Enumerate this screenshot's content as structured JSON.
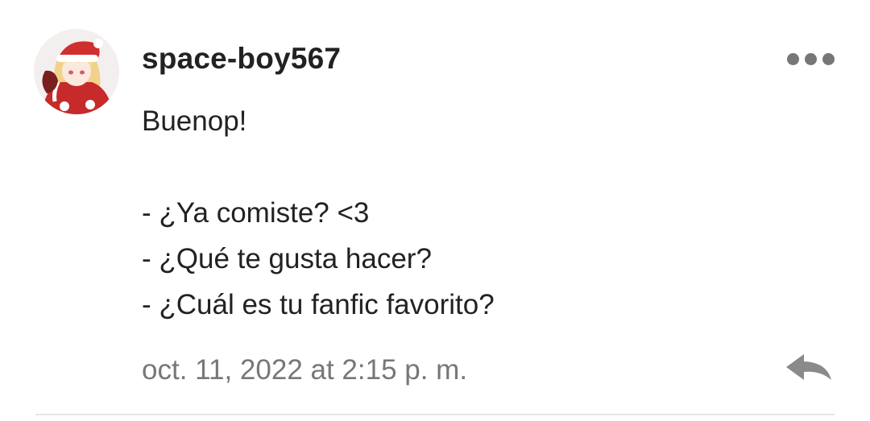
{
  "comment": {
    "username": "space-boy567",
    "avatar_icon": "avatar-santa-girl-icon",
    "message_lines": [
      "Buenop!",
      "",
      "- ¿Ya comiste? <3",
      "- ¿Qué te gusta hacer?",
      "- ¿Cuál es tu fanfic favorito?"
    ],
    "timestamp": "oct. 11, 2022 at 2:15 p. m.",
    "more_icon": "more-options-icon",
    "reply_icon": "reply-arrow-icon"
  },
  "colors": {
    "text": "#222222",
    "muted": "#777777",
    "divider": "#e6e6e6",
    "background": "#ffffff"
  }
}
